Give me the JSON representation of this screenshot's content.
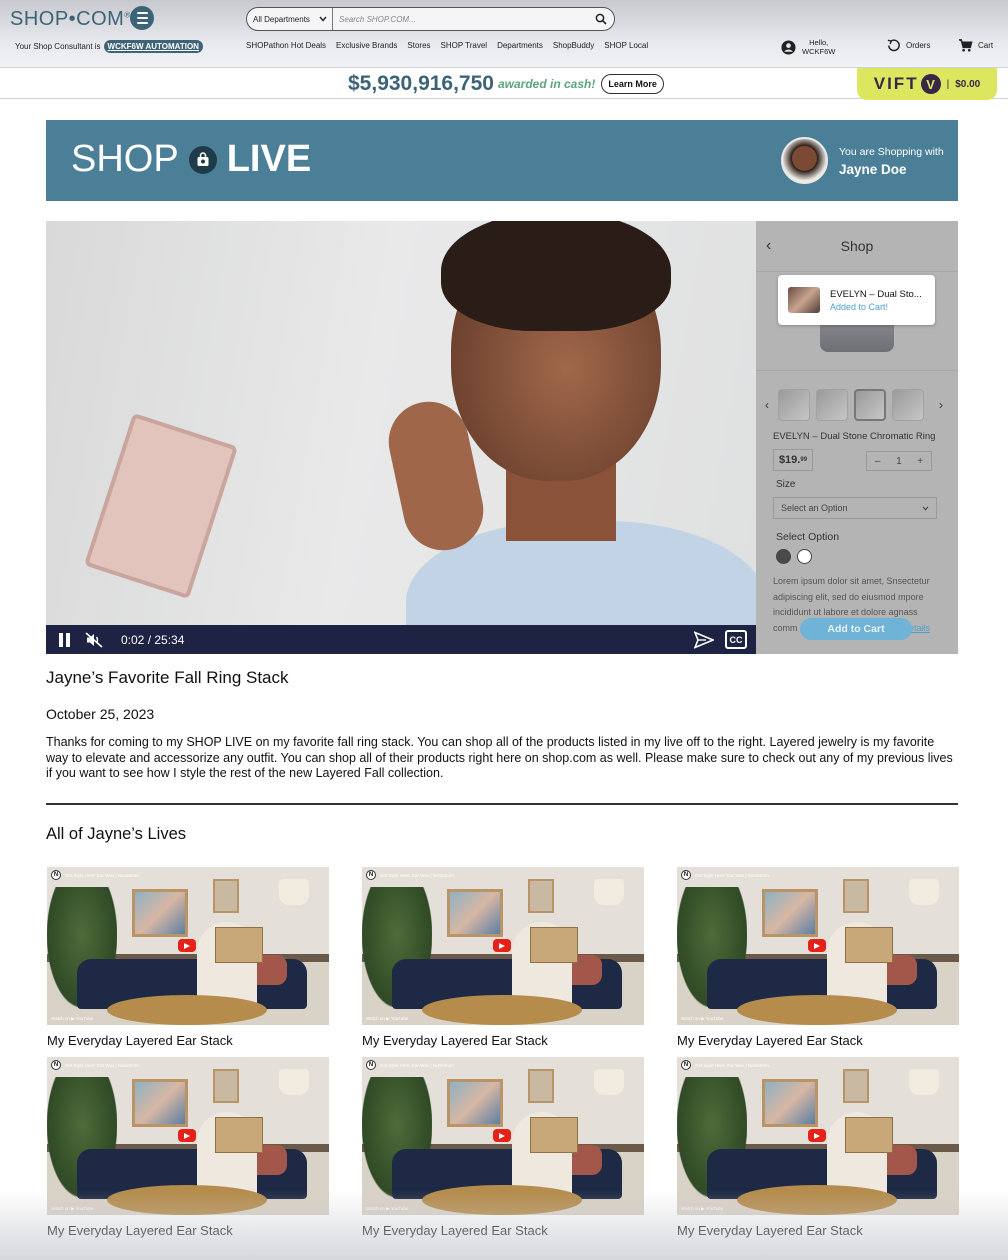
{
  "header": {
    "logo": "SHOP•COM",
    "logo_mark": "®",
    "consultant_prefix": "Your Shop Consultant is",
    "consultant_name": "WCKF6W AUTOMATION",
    "search": {
      "department": "All Departments",
      "placeholder": "Search SHOP.COM..."
    },
    "nav": [
      "SHOPathon Hot Deals",
      "Exclusive Brands",
      "Stores",
      "SHOP Travel",
      "Departments",
      "ShopBuddy",
      "SHOP Local"
    ],
    "account": {
      "line1": "Hello,",
      "line2": "WCKF6W"
    },
    "orders_label": "Orders",
    "cart_label": "Cart"
  },
  "award": {
    "amount": "$5,930,916,750",
    "text": "awarded in cash!",
    "button": "Learn More"
  },
  "vift": {
    "brand_left": "VIFT",
    "brand_mark": "V",
    "separator": "|",
    "amount": "$0.00"
  },
  "banner": {
    "title_left": "SHOP",
    "title_right": "LIVE",
    "shopping_with": "You are Shopping with",
    "host": "Jayne Doe"
  },
  "video": {
    "time": "0:02 / 25:34",
    "cc": "CC"
  },
  "shop_panel": {
    "title": "Shop",
    "back": "‹",
    "toast_title": "EVELYN – Dual Sto...",
    "toast_sub": "Added to Cart!",
    "thumb_prev": "‹",
    "thumb_next": "›",
    "product_name": "EVELYN – Dual Stone Chromatic Ring",
    "price_main": "$19.",
    "price_cents": "99",
    "qty_minus": "–",
    "qty_value": "1",
    "qty_plus": "+",
    "size_label": "Size",
    "size_placeholder": "Select an Option",
    "option_label": "Select Option",
    "description": "Lorem ipsum dolor sit amet, Snsectetur adipiscing elit, sed do eiusmod mpore incididunt ut labore et dolore agnass comm",
    "details_link": "etails",
    "add_to_cart": "Add to Cart"
  },
  "live": {
    "title": "Jayne’s Favorite Fall Ring Stack",
    "date": "October 25, 2023",
    "description": "Thanks for coming to my SHOP LIVE on my favorite fall ring stack. You can shop all of the products listed in my live off to the right. Layered jewelry is my favorite way to elevate and accessorize any outfit. You can shop all of their products right here on shop.com as well. Please make sure to check out any of my previous lives if you want to see how I style the rest of the new Layered Fall collection."
  },
  "lives": {
    "heading": "All of Jayne’s Lives",
    "yt_channel": "N",
    "yt_title": "Get Style Here: Ear Wax | Nordstrom",
    "yt_watch": "Watch on ▶ YouTube",
    "items": [
      {
        "title": "My Everyday Layered Ear Stack"
      },
      {
        "title": "My Everyday Layered Ear Stack"
      },
      {
        "title": "My Everyday Layered Ear Stack"
      },
      {
        "title": "My Everyday Layered Ear Stack"
      },
      {
        "title": "My Everyday Layered Ear Stack"
      },
      {
        "title": "My Everyday Layered Ear Stack"
      }
    ]
  }
}
